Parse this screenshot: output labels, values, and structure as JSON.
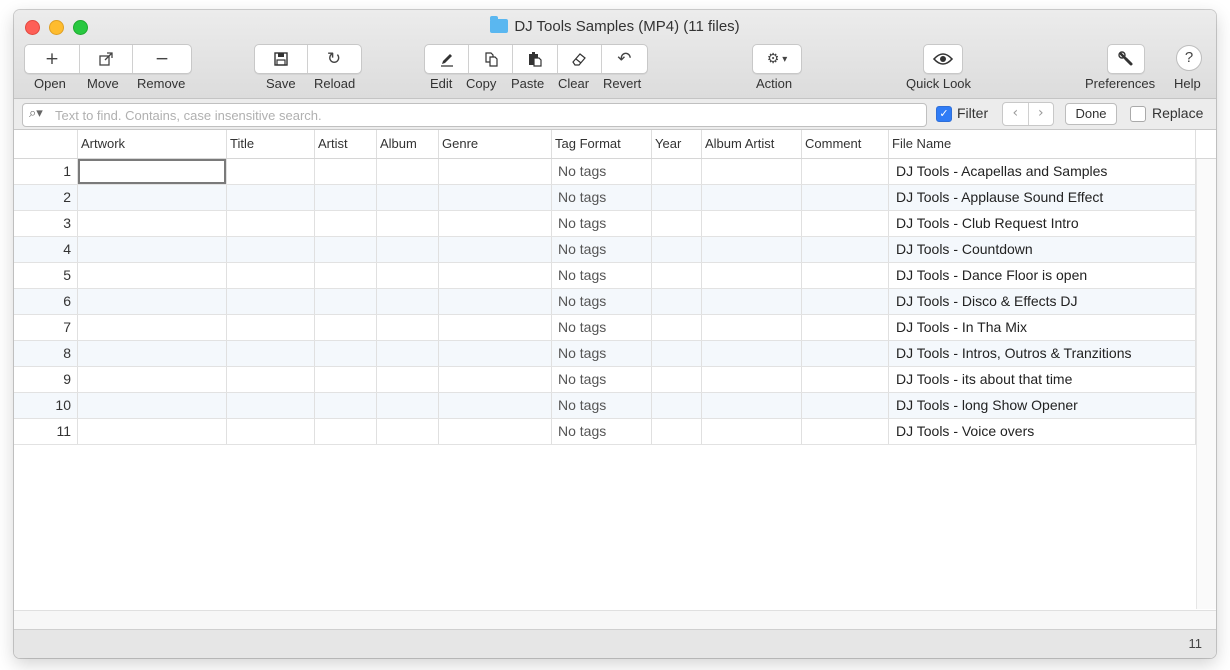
{
  "window": {
    "title": "DJ Tools Samples (MP4) (11 files)"
  },
  "toolbar": {
    "open_label": "Open",
    "move_label": "Move",
    "remove_label": "Remove",
    "save_label": "Save",
    "reload_label": "Reload",
    "edit_label": "Edit",
    "copy_label": "Copy",
    "paste_label": "Paste",
    "clear_label": "Clear",
    "revert_label": "Revert",
    "action_label": "Action",
    "quicklook_label": "Quick Look",
    "preferences_label": "Preferences",
    "help_label": "Help"
  },
  "search": {
    "placeholder": "Text to find. Contains, case insensitive search.",
    "filter_label": "Filter",
    "filter_checked": true,
    "done_label": "Done",
    "replace_label": "Replace",
    "replace_checked": false
  },
  "table": {
    "columns": [
      "Artwork",
      "Title",
      "Artist",
      "Album",
      "Genre",
      "Tag Format",
      "Year",
      "Album Artist",
      "Comment",
      "File Name"
    ],
    "rows": [
      {
        "num": "1",
        "tag_format": "No tags",
        "file_name": "DJ Tools - Acapellas and Samples"
      },
      {
        "num": "2",
        "tag_format": "No tags",
        "file_name": "DJ Tools - Applause Sound Effect"
      },
      {
        "num": "3",
        "tag_format": "No tags",
        "file_name": "DJ Tools - Club Request Intro"
      },
      {
        "num": "4",
        "tag_format": "No tags",
        "file_name": "DJ Tools - Countdown"
      },
      {
        "num": "5",
        "tag_format": "No tags",
        "file_name": "DJ Tools - Dance Floor is open"
      },
      {
        "num": "6",
        "tag_format": "No tags",
        "file_name": "DJ Tools - Disco & Effects DJ"
      },
      {
        "num": "7",
        "tag_format": "No tags",
        "file_name": "DJ Tools - In Tha Mix"
      },
      {
        "num": "8",
        "tag_format": "No tags",
        "file_name": "DJ Tools - Intros, Outros & Tranzitions"
      },
      {
        "num": "9",
        "tag_format": "No tags",
        "file_name": "DJ Tools - its about that time"
      },
      {
        "num": "10",
        "tag_format": "No tags",
        "file_name": "DJ Tools - long Show Opener"
      },
      {
        "num": "11",
        "tag_format": "No tags",
        "file_name": "DJ Tools - Voice overs"
      }
    ]
  },
  "status": {
    "count": "11"
  },
  "colors": {
    "accent": "#2f7cf6",
    "close": "#fe5f57",
    "minimize": "#febc2e",
    "maximize": "#28c840",
    "folder": "#5ab7f0"
  }
}
